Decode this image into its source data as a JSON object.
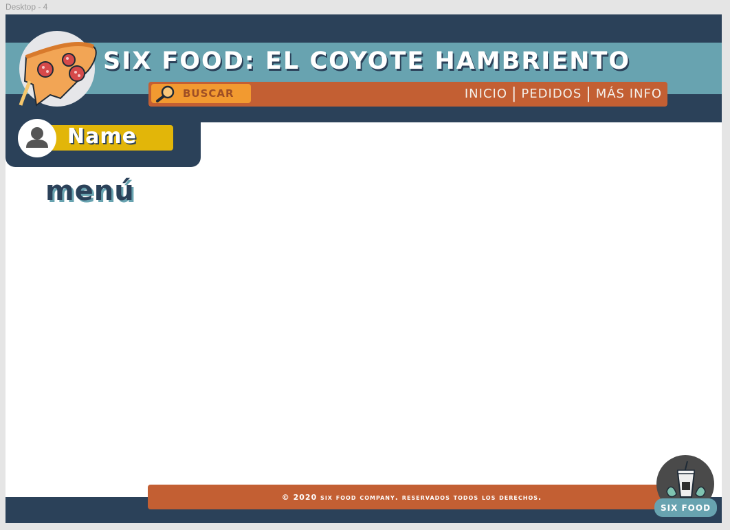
{
  "frame": {
    "label": "Desktop - 4"
  },
  "header": {
    "title": "SIX FOOD: EL COYOTE HAMBRIENTO",
    "logo_icon": "pizza-icon",
    "search": {
      "label": "BUSCAR",
      "icon": "magnifier-icon"
    },
    "nav": [
      {
        "label": "INICIO"
      },
      {
        "label": "PEDIDOS"
      },
      {
        "label": "MÁS INFO"
      }
    ],
    "nav_separator": "|"
  },
  "user": {
    "name": "Name",
    "avatar_icon": "user-icon"
  },
  "main": {
    "heading": "menú"
  },
  "footer": {
    "copyright": "© 2020 SIX FOOD COMPANY. RESERVADOS TODOS LOS DERECHOS.",
    "brand_label": "SIX FOOD",
    "brand_icon": "drink-cup-icon"
  },
  "colors": {
    "navy": "#2b4159",
    "teal": "#68a3b0",
    "rust": "#c35f33",
    "orange": "#f29a30",
    "mustard": "#e2b609"
  }
}
